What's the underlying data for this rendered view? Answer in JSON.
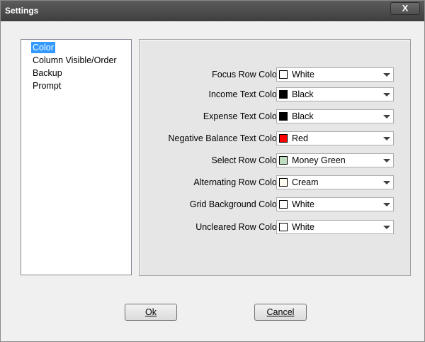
{
  "window": {
    "title": "Settings",
    "close_label": "X"
  },
  "tree": {
    "items": [
      {
        "label": "Color",
        "selected": true
      },
      {
        "label": "Column Visible/Order",
        "selected": false
      },
      {
        "label": "Backup",
        "selected": false
      },
      {
        "label": "Prompt",
        "selected": false
      }
    ]
  },
  "settings": {
    "rows": [
      {
        "label": "Focus Row Color",
        "value": "White",
        "swatch": "#ffffff"
      },
      {
        "label": "Income Text Color",
        "value": "Black",
        "swatch": "#000000"
      },
      {
        "label": "Expense Text Color",
        "value": "Black",
        "swatch": "#000000"
      },
      {
        "label": "Negative Balance Text Color",
        "value": "Red",
        "swatch": "#ff0000"
      },
      {
        "label": "Select Row Color",
        "value": "Money Green",
        "swatch": "#c0dcc0"
      },
      {
        "label": "Alternating Row Color",
        "value": "Cream",
        "swatch": "#fffbf0"
      },
      {
        "label": "Grid Background Color",
        "value": "White",
        "swatch": "#ffffff"
      },
      {
        "label": "Uncleared Row Color",
        "value": "White",
        "swatch": "#ffffff"
      }
    ]
  },
  "buttons": {
    "ok_label": "Ok",
    "cancel_label": "Cancel"
  }
}
